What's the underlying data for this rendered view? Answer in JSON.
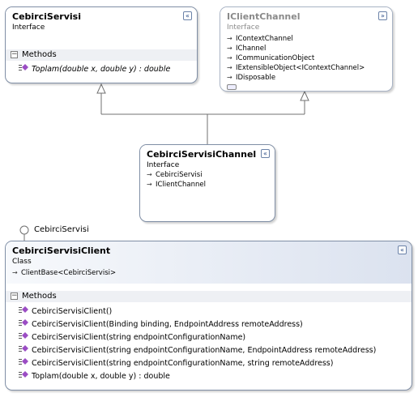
{
  "colors": {
    "border": "#7f8ea5",
    "header_gradient_end": "#dbe2ef",
    "method_icon": "#9b4dc4",
    "connector": "#707070"
  },
  "cebirci_servisi": {
    "title": "CebirciServisi",
    "stereotype": "Interface",
    "collapse_glyph": "«",
    "methods_header": "Methods",
    "methods": [
      "Toplam(double x, double y) : double"
    ]
  },
  "iclient_channel": {
    "title": "IClientChannel",
    "stereotype": "Interface",
    "expand_glyph": "»",
    "inherits": [
      "IContextChannel",
      "IChannel",
      "ICommunicationObject",
      "IExtensibleObject<IContextChannel>",
      "IDisposable"
    ]
  },
  "channel": {
    "title": "CebirciServisiChannel",
    "stereotype": "Interface",
    "collapse_glyph": "«",
    "inherits": [
      "CebirciServisi",
      "IClientChannel"
    ]
  },
  "lollipop": {
    "label": "CebirciServisi"
  },
  "client": {
    "title": "CebirciServisiClient",
    "stereotype": "Class",
    "collapse_glyph": "«",
    "base": "ClientBase<CebirciServisi>",
    "methods_header": "Methods",
    "methods": [
      "CebirciServisiClient()",
      "CebirciServisiClient(Binding binding, EndpointAddress remoteAddress)",
      "CebirciServisiClient(string endpointConfigurationName)",
      "CebirciServisiClient(string endpointConfigurationName, EndpointAddress remoteAddress)",
      "CebirciServisiClient(string endpointConfigurationName, string remoteAddress)",
      "Toplam(double x, double y) : double"
    ]
  }
}
